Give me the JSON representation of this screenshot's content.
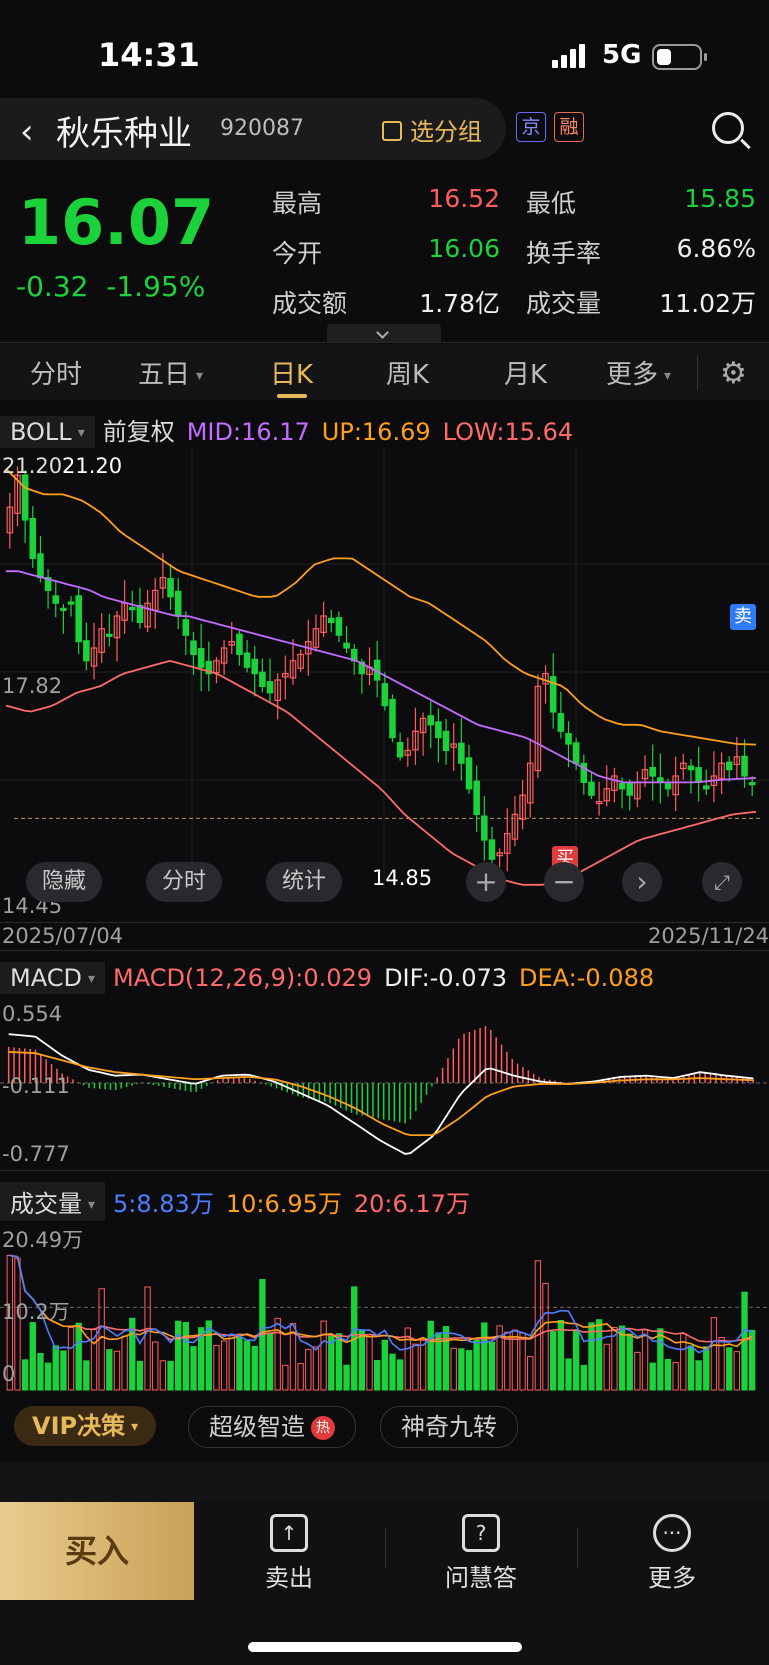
{
  "status": {
    "time": "14:31",
    "network": "5G"
  },
  "header": {
    "name": "秋乐种业",
    "code": "920087",
    "group_btn": "选分组",
    "badge1": "京",
    "badge2": "融"
  },
  "quote": {
    "price": "16.07",
    "change": "-0.32",
    "change_pct": "-1.95%",
    "stats": [
      {
        "label": "最高",
        "value": "16.52",
        "color": "#ff5c5c"
      },
      {
        "label": "最低",
        "value": "15.85",
        "color": "#1bd23a"
      },
      {
        "label": "今开",
        "value": "16.06",
        "color": "#1bd23a"
      },
      {
        "label": "换手率",
        "value": "6.86%",
        "color": "#f0f0f0"
      },
      {
        "label": "成交额",
        "value": "1.78亿",
        "color": "#f0f0f0"
      },
      {
        "label": "成交量",
        "value": "11.02万",
        "color": "#f0f0f0"
      }
    ]
  },
  "tabs": [
    {
      "label": "分时"
    },
    {
      "label": "五日"
    },
    {
      "label": "日K"
    },
    {
      "label": "周K"
    },
    {
      "label": "月K"
    },
    {
      "label": "更多"
    }
  ],
  "boll": {
    "name": "BOLL",
    "adj": "前复权",
    "mid": "MID:16.17",
    "up": "UP:16.69",
    "low": "LOW:15.64"
  },
  "kline_labels": {
    "top": "21.20",
    "high_marker": "21.20",
    "mid": "17.82",
    "bottom": "14.45",
    "low_marker": "14.85",
    "date_start": "2025/07/04",
    "date_end": "2025/11/24",
    "buy": "买",
    "sell": "卖"
  },
  "chart_buttons": {
    "hide": "隐藏",
    "fenshi": "分时",
    "stats": "统计"
  },
  "macd": {
    "name": "MACD",
    "params": "MACD(12,26,9):0.029",
    "dif": "DIF:-0.073",
    "dea": "DEA:-0.088",
    "top": "0.554",
    "mid": "-0.111",
    "bottom": "-0.777"
  },
  "volume": {
    "name": "成交量",
    "ma5": "5:8.83万",
    "ma10": "10:6.95万",
    "ma20": "20:6.17万",
    "top": "20.49万",
    "mid": "10.2万",
    "bottom": "0"
  },
  "feature_row": {
    "vip": "VIP决策",
    "smart": "超级智造",
    "hot": "热",
    "nine": "神奇九转"
  },
  "bottom_nav": {
    "buy": "买入",
    "sell": "卖出",
    "ask": "问慧答",
    "more": "更多"
  },
  "chart_data": [
    {
      "type": "candlestick",
      "title": "",
      "x_range": [
        "2025/07/04",
        "2025/11/24"
      ],
      "ylim": [
        14.45,
        21.2
      ],
      "close": [
        20.4,
        20.9,
        20.2,
        19.6,
        19.3,
        19.1,
        18.9,
        18.8,
        18.9,
        18.3,
        18.0,
        18.2,
        18.5,
        18.4,
        18.7,
        18.9,
        18.8,
        18.6,
        18.9,
        19.1,
        19.3,
        19.0,
        18.7,
        18.4,
        18.1,
        17.9,
        17.8,
        18.0,
        18.2,
        18.3,
        18.1,
        17.9,
        17.8,
        17.6,
        17.5,
        17.7,
        17.8,
        18.0,
        18.1,
        18.3,
        18.5,
        18.7,
        18.6,
        18.4,
        18.2,
        18.0,
        17.8,
        17.9,
        17.7,
        17.3,
        16.8,
        16.5,
        16.6,
        16.9,
        17.1,
        17.0,
        16.8,
        16.6,
        16.7,
        16.4,
        16.0,
        15.6,
        15.2,
        14.9,
        15.0,
        15.3,
        15.6,
        15.9,
        16.4,
        17.6,
        17.8,
        17.2,
        16.9,
        16.7,
        16.4,
        16.1,
        15.9,
        15.8,
        16.0,
        16.2,
        16.0,
        15.9,
        16.1,
        16.3,
        16.2,
        16.1,
        16.0,
        16.2,
        16.4,
        16.3,
        16.1,
        16.0,
        16.2,
        16.4,
        16.3,
        16.5,
        16.2,
        16.07
      ],
      "ma_mid": [
        19.4,
        19.4,
        19.35,
        19.3,
        19.25,
        19.2,
        19.15,
        19.1,
        19.0,
        18.95,
        18.9,
        18.85,
        18.8,
        18.75,
        18.7,
        18.7,
        18.65,
        18.6,
        18.55,
        18.5,
        18.45,
        18.4,
        18.35,
        18.3,
        18.25,
        18.2,
        18.15,
        18.1,
        18.05,
        18.0,
        17.9,
        17.8,
        17.7,
        17.6,
        17.5,
        17.4,
        17.3,
        17.2,
        17.1,
        17.0,
        16.95,
        16.9,
        16.85,
        16.8,
        16.7,
        16.6,
        16.5,
        16.4,
        16.3,
        16.2,
        16.15,
        16.1,
        16.1,
        16.1,
        16.1,
        16.1,
        16.1,
        16.1,
        16.12,
        16.14,
        16.15,
        16.16,
        16.17
      ],
      "up": [
        21.0,
        20.7,
        20.6,
        20.6,
        20.5,
        20.3,
        20.0,
        19.8,
        19.6,
        19.4,
        19.3,
        19.2,
        19.1,
        19.0,
        19.0,
        19.2,
        19.5,
        19.6,
        19.6,
        19.4,
        19.2,
        19.0,
        18.9,
        18.7,
        18.5,
        18.3,
        18.0,
        17.8,
        17.7,
        17.6,
        17.3,
        17.1,
        17.0,
        17.0,
        16.9,
        16.85,
        16.8,
        16.75,
        16.7,
        16.69
      ],
      "low": [
        17.3,
        17.2,
        17.3,
        17.5,
        17.6,
        17.8,
        17.9,
        18.0,
        17.9,
        17.8,
        17.6,
        17.4,
        17.2,
        16.9,
        16.6,
        16.3,
        16.0,
        15.6,
        15.3,
        15.0,
        14.8,
        14.6,
        14.5,
        14.5,
        14.6,
        14.8,
        15.0,
        15.2,
        15.3,
        15.4,
        15.5,
        15.6,
        15.64
      ]
    },
    {
      "type": "bar",
      "title": "MACD",
      "ylim": [
        -0.777,
        0.554
      ],
      "dif_final": -0.073,
      "dea_final": -0.088,
      "macd_final": 0.029
    },
    {
      "type": "bar",
      "title": "成交量",
      "ylim": [
        0,
        20.49
      ],
      "ma5": 8.83,
      "ma10": 6.95,
      "ma20": 6.17
    }
  ]
}
